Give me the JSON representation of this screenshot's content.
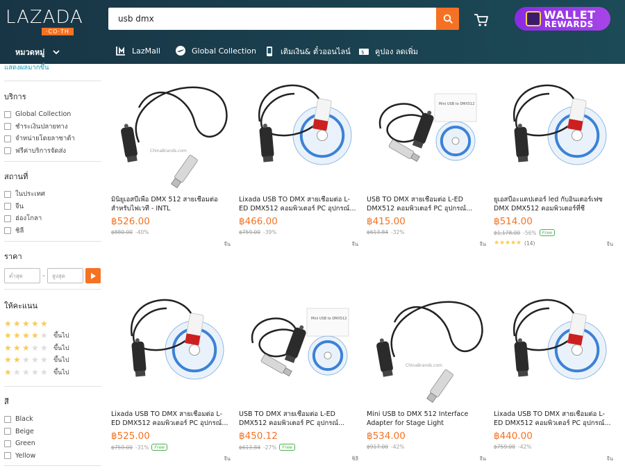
{
  "header": {
    "logo_text": "LAZADA",
    "logo_sub": "·CO·TH",
    "search_value": "usb dmx",
    "wallet_line1": "WALLET",
    "wallet_line2": "REWARDS",
    "categories_label": "หมวดหมู่",
    "nav": [
      {
        "label": "LazMall",
        "icon": "lazmall-icon"
      },
      {
        "label": "Global Collection",
        "icon": "plane-icon"
      },
      {
        "label": "เติมเงิน& ตั๋วออนไลน์",
        "icon": "phone-icon"
      },
      {
        "label": "คูปอง ลดเพิ่ม",
        "icon": "coupon-icon"
      }
    ],
    "accent": "#f57224"
  },
  "sidebar": {
    "show_more": "แสดงผลมากขึ้น",
    "service": {
      "title": "บริการ",
      "items": [
        "Global Collection",
        "ชำระเงินปลายทาง",
        "จำหน่ายโดยลาซาด้า",
        "ฟรีค่าบริการจัดส่ง"
      ]
    },
    "location": {
      "title": "สถานที่",
      "items": [
        "ในประเทศ",
        "จีน",
        "ฮ่องโกลา",
        "ชิลี"
      ]
    },
    "price": {
      "title": "ราคา",
      "min_placeholder": "ต่ำสุด",
      "max_placeholder": "สูงสุด",
      "dash": "-"
    },
    "rating": {
      "title": "ให้คะแนน",
      "rows": [
        {
          "stars": 5,
          "label": ""
        },
        {
          "stars": 4,
          "label": "ขึ้นไป"
        },
        {
          "stars": 3,
          "label": "ขึ้นไป"
        },
        {
          "stars": 2,
          "label": "ขึ้นไป"
        },
        {
          "stars": 1,
          "label": "ขึ้นไป"
        }
      ]
    },
    "color": {
      "title": "สี",
      "items": [
        "Black",
        "Beige",
        "Green",
        "Yellow"
      ]
    }
  },
  "products": [
    {
      "title": "มินิยูเอสบีเพื่อ DMX 512 สายเชื่อมต่อสำหรับไฟเวที - INTL",
      "price": "฿526.00",
      "old_price": "฿880.00",
      "discount": "-40%",
      "free": false,
      "rating": null,
      "reviews": "",
      "location": "จีน",
      "img": "coil-long"
    },
    {
      "title": "Lixada USB TO DMX สายเชื่อมต่อ L-ED DMX512 คอมพิวเตอร์ PC อุปกรณ์...",
      "price": "฿466.00",
      "old_price": "฿759.00",
      "discount": "-39%",
      "free": false,
      "rating": null,
      "reviews": "",
      "location": "จีน",
      "img": "coil-cd"
    },
    {
      "title": "USB TO DMX สายเชื่อมต่อ L-ED DMX512 คอมพิวเตอร์ PC อุปกรณ์...",
      "price": "฿415.00",
      "old_price": "฿613.84",
      "discount": "-32%",
      "free": false,
      "rating": null,
      "reviews": "",
      "location": "จีน",
      "img": "coil-card"
    },
    {
      "title": "ยูเอสบีอะแดปเตอร์ led กับอินเตอร์เฟซ DMX DMX512 คอมพิวเตอร์ที่ชีควบคุม...",
      "price": "฿514.00",
      "old_price": "฿1,178.00",
      "discount": "-56%",
      "free": true,
      "rating": 4.5,
      "reviews": "(14)",
      "location": "จีน",
      "img": "coil-cd-big"
    },
    {
      "title": "Lixada USB TO DMX สายเชื่อมต่อ L-ED DMX512 คอมพิวเตอร์ PC อุปกรณ์...",
      "price": "฿525.00",
      "old_price": "฿759.00",
      "discount": "-31%",
      "free": true,
      "rating": null,
      "reviews": "",
      "location": "จีน",
      "img": "coil-cd"
    },
    {
      "title": "USB TO DMX สายเชื่อมต่อ L-ED DMX512 คอมพิวเตอร์ PC อุปกรณ์...",
      "price": "฿450.12",
      "old_price": "฿613.84",
      "discount": "-27%",
      "free": true,
      "rating": null,
      "reviews": "",
      "location": "ชิลี",
      "img": "coil-card"
    },
    {
      "title": "Mini USB to DMX 512 Interface Adapter for Stage Light",
      "price": "฿534.00",
      "old_price": "฿917.00",
      "discount": "-42%",
      "free": false,
      "rating": null,
      "reviews": "",
      "location": "จีน",
      "img": "coil-long"
    },
    {
      "title": "Lixada USB TO DMX สายเชื่อมต่อ L-ED DMX512 คอมพิวเตอร์ PC อุปกรณ์...",
      "price": "฿440.00",
      "old_price": "฿759.00",
      "discount": "-42%",
      "free": false,
      "rating": null,
      "reviews": "",
      "location": "จีน",
      "img": "coil-cd"
    }
  ],
  "free_label": "Free"
}
